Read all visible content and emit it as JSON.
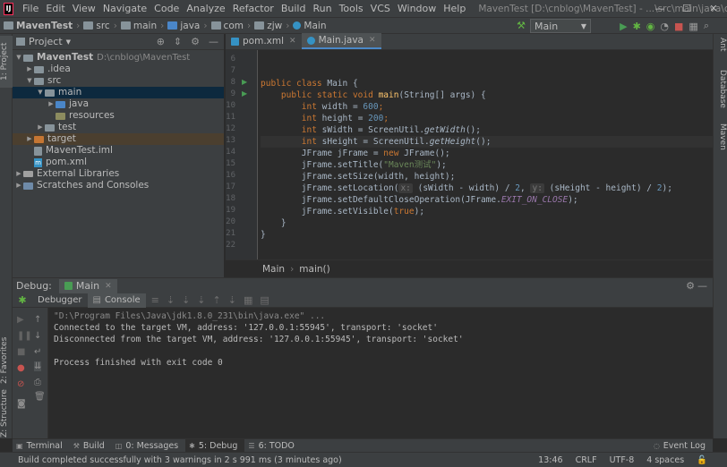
{
  "menubar": {
    "items": [
      "File",
      "Edit",
      "View",
      "Navigate",
      "Code",
      "Analyze",
      "Refactor",
      "Build",
      "Run",
      "Tools",
      "VCS",
      "Window",
      "Help"
    ],
    "window_title": "MavenTest [D:\\cnblog\\MavenTest] - ...\\src\\main\\java\\com\\zjw\\Main.java",
    "minimize": "—",
    "maximize": "☐",
    "close": "✕"
  },
  "navbar": {
    "crumbs": [
      "MavenTest",
      "src",
      "main",
      "java",
      "com",
      "zjw",
      "Main"
    ],
    "run_config": "Main"
  },
  "leftstrip": {
    "project_tab": "1: Project",
    "favorites_tab": "2: Favorites",
    "structure_tab": "Z: Structure"
  },
  "rightstrip": {
    "ant": "Ant",
    "database": "Database",
    "maven": "Maven"
  },
  "project": {
    "header": "Project",
    "tree": [
      {
        "label": "MavenTest",
        "path": "D:\\cnblog\\MavenTest"
      },
      {
        "label": ".idea"
      },
      {
        "label": "src"
      },
      {
        "label": "main"
      },
      {
        "label": "java"
      },
      {
        "label": "resources"
      },
      {
        "label": "test"
      },
      {
        "label": "target"
      },
      {
        "label": "MavenTest.iml"
      },
      {
        "label": "pom.xml"
      },
      {
        "label": "External Libraries"
      },
      {
        "label": "Scratches and Consoles"
      }
    ]
  },
  "editor": {
    "tabs": [
      "pom.xml",
      "Main.java"
    ],
    "line_numbers": [
      "6",
      "7",
      "8",
      "9",
      "10",
      "11",
      "12",
      "13",
      "14",
      "15",
      "16",
      "17",
      "18",
      "19",
      "20",
      "21",
      "22"
    ],
    "lines": {
      "l8_kw": "public class",
      "l8_name": " Main {",
      "l9_kw": "public static void",
      "l9_fn": "main",
      "l9_rest": "(String[] args) {",
      "l10_kw": "int",
      "l10_a": " width = ",
      "l10_n": "600",
      "l10_e": ";",
      "l11_kw": "int",
      "l11_a": " height = ",
      "l11_n": "200",
      "l11_e": ";",
      "l12_kw": "int",
      "l12_a": " sWidth = ScreenUtil.",
      "l12_m": "getWidth",
      "l12_e": "();",
      "l13_kw": "int",
      "l13_a": " sHeight = ScreenUtil.",
      "l13_m": "getHeight",
      "l13_e": "();",
      "l14_a": "JFrame jFrame = ",
      "l14_kw": "new",
      "l14_e": " JFrame();",
      "l15_a": "jFrame.setTitle(",
      "l15_s": "\"Maven测试\"",
      "l15_e": ");",
      "l16_a": "jFrame.setSize(width, height);",
      "l17_a": "jFrame.setLocation(",
      "l17_h1": "x:",
      "l17_b": " (sWidth - width) / ",
      "l17_n1": "2",
      "l17_c": ", ",
      "l17_h2": "y:",
      "l17_d": " (sHeight - height) / ",
      "l17_n2": "2",
      "l17_e": ");",
      "l18_a": "jFrame.setDefaultCloseOperation(JFrame.",
      "l18_f": "EXIT_ON_CLOSE",
      "l18_e": ");",
      "l19_a": "jFrame.setVisible(",
      "l19_kw": "true",
      "l19_e": ");",
      "l20": "}",
      "l21": "}"
    },
    "breadcrumb": [
      "Main",
      "main()"
    ]
  },
  "debug": {
    "label": "Debug:",
    "session": "Main",
    "tabs": [
      "Debugger",
      "Console"
    ],
    "console": [
      "\"D:\\Program Files\\Java\\jdk1.8.0_231\\bin\\java.exe\" ...",
      "Connected to the target VM, address: '127.0.0.1:55945', transport: 'socket'",
      "Disconnected from the target VM, address: '127.0.0.1:55945', transport: 'socket'",
      "",
      "Process finished with exit code 0"
    ]
  },
  "bottom_tabs": [
    "Terminal",
    "Build",
    "0: Messages",
    "5: Debug",
    "6: TODO"
  ],
  "event_log": "Event Log",
  "status": {
    "message": "Build completed successfully with 3 warnings in 2 s 991 ms (3 minutes ago)",
    "position": "13:46",
    "line_sep": "CRLF",
    "encoding": "UTF-8",
    "indent": "4 spaces"
  },
  "colors": {
    "accent": "#4a88c7",
    "run_green": "#499c54",
    "keyword": "#cc7832",
    "string": "#6a8759",
    "number": "#6897bb"
  }
}
